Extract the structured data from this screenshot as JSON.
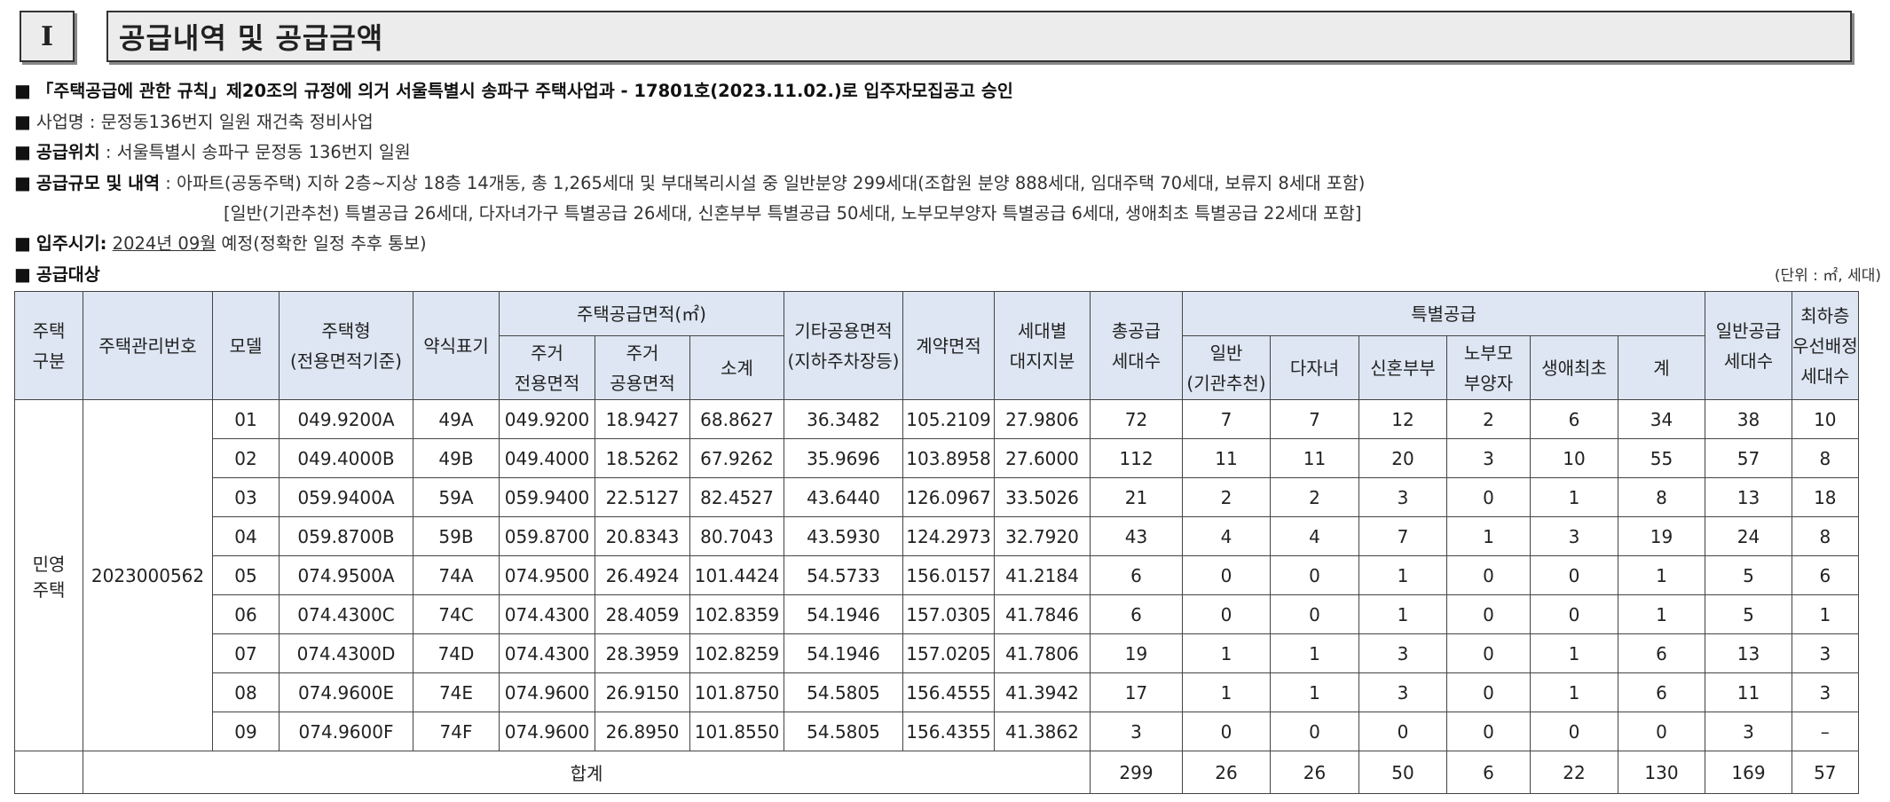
{
  "section": {
    "number": "I",
    "title": "공급내역 및 공급금액"
  },
  "info": {
    "approval": "「주택공급에 관한 규칙」제20조의 규정에 의거 서울특별시 송파구 주택사업과 - 17801호(2023.11.02.)로 입주자모집공고 승인",
    "project_label": "사업명",
    "project_value": " : 문정동136번지 일원 재건축 정비사업",
    "location_label": "공급위치",
    "location_value": " : 서울특별시 송파구 문정동 136번지 일원",
    "scale_label": "공급규모 및 내역",
    "scale_value": " : 아파트(공동주택) 지하 2층~지상 18층 14개동, 총 1,265세대 및 부대복리시설 중 일반분양 299세대(조합원 분양 888세대, 임대주택 70세대, 보류지 8세대 포함)",
    "scale_detail": "[일반(기관추천) 특별공급 26세대, 다자녀가구 특별공급 26세대, 신혼부부 특별공급 50세대, 노부모부양자 특별공급 6세대, 생애최초 특별공급 22세대 포함]",
    "movein_label": "입주시기:",
    "movein_date": "2024년 09월",
    "movein_note": " 예정(정확한 일정 추후 통보)",
    "target_label": "공급대상",
    "unit_note": "(단위 : ㎡, 세대)"
  },
  "table": {
    "headers": {
      "housing_type": "주택\n구분",
      "management_no": "주택관리번호",
      "model": "모델",
      "house_type": "주택형\n(전용면적기준)",
      "abbr": "약식표기",
      "supply_area": "주택공급면적(㎡)",
      "exclusive": "주거\n전용면적",
      "common": "주거\n공용면적",
      "subtotal": "소계",
      "other_common": "기타공용면적\n(지하주차장등)",
      "contract_area": "계약면적",
      "land_share": "세대별\n대지지분",
      "total_supply": "총공급\n세대수",
      "special": "특별공급",
      "sp_general": "일반\n(기관추천)",
      "sp_multichild": "다자녀",
      "sp_newlywed": "신혼부부",
      "sp_elderly": "노부모\n부양자",
      "sp_firsttime": "생애최초",
      "sp_sum": "계",
      "general_supply": "일반공급\n세대수",
      "lowest_floor": "최하층\n우선배정\n세대수"
    },
    "category": "민영\n주택",
    "management_number": "2023000562",
    "rows": [
      [
        "01",
        "049.9200A",
        "49A",
        "049.9200",
        "18.9427",
        "68.8627",
        "36.3482",
        "105.2109",
        "27.9806",
        "72",
        "7",
        "7",
        "12",
        "2",
        "6",
        "34",
        "38",
        "10"
      ],
      [
        "02",
        "049.4000B",
        "49B",
        "049.4000",
        "18.5262",
        "67.9262",
        "35.9696",
        "103.8958",
        "27.6000",
        "112",
        "11",
        "11",
        "20",
        "3",
        "10",
        "55",
        "57",
        "8"
      ],
      [
        "03",
        "059.9400A",
        "59A",
        "059.9400",
        "22.5127",
        "82.4527",
        "43.6440",
        "126.0967",
        "33.5026",
        "21",
        "2",
        "2",
        "3",
        "0",
        "1",
        "8",
        "13",
        "18"
      ],
      [
        "04",
        "059.8700B",
        "59B",
        "059.8700",
        "20.8343",
        "80.7043",
        "43.5930",
        "124.2973",
        "32.7920",
        "43",
        "4",
        "4",
        "7",
        "1",
        "3",
        "19",
        "24",
        "8"
      ],
      [
        "05",
        "074.9500A",
        "74A",
        "074.9500",
        "26.4924",
        "101.4424",
        "54.5733",
        "156.0157",
        "41.2184",
        "6",
        "0",
        "0",
        "1",
        "0",
        "0",
        "1",
        "5",
        "6"
      ],
      [
        "06",
        "074.4300C",
        "74C",
        "074.4300",
        "28.4059",
        "102.8359",
        "54.1946",
        "157.0305",
        "41.7846",
        "6",
        "0",
        "0",
        "1",
        "0",
        "0",
        "1",
        "5",
        "1"
      ],
      [
        "07",
        "074.4300D",
        "74D",
        "074.4300",
        "28.3959",
        "102.8259",
        "54.1946",
        "157.0205",
        "41.7806",
        "19",
        "1",
        "1",
        "3",
        "0",
        "1",
        "6",
        "13",
        "3"
      ],
      [
        "08",
        "074.9600E",
        "74E",
        "074.9600",
        "26.9150",
        "101.8750",
        "54.5805",
        "156.4555",
        "41.3942",
        "17",
        "1",
        "1",
        "3",
        "0",
        "1",
        "6",
        "11",
        "3"
      ],
      [
        "09",
        "074.9600F",
        "74F",
        "074.9600",
        "26.8950",
        "101.8550",
        "54.5805",
        "156.4355",
        "41.3862",
        "3",
        "0",
        "0",
        "0",
        "0",
        "0",
        "0",
        "3",
        "–"
      ]
    ],
    "total": {
      "label": "합계",
      "values": [
        "299",
        "26",
        "26",
        "50",
        "6",
        "22",
        "130",
        "169",
        "57"
      ]
    }
  }
}
